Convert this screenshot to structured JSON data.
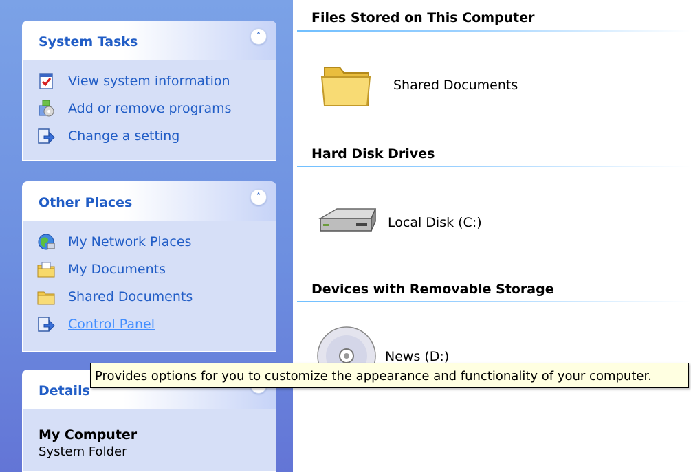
{
  "task_pane": {
    "system_tasks": {
      "title": "System Tasks",
      "items": [
        {
          "label": "View system information",
          "icon": "system-info-icon"
        },
        {
          "label": "Add or remove programs",
          "icon": "add-remove-programs-icon"
        },
        {
          "label": "Change a setting",
          "icon": "control-panel-icon"
        }
      ]
    },
    "other_places": {
      "title": "Other Places",
      "items": [
        {
          "label": "My Network Places",
          "icon": "network-places-icon"
        },
        {
          "label": "My Documents",
          "icon": "my-documents-icon"
        },
        {
          "label": "Shared Documents",
          "icon": "folder-icon"
        },
        {
          "label": "Control Panel",
          "icon": "control-panel-icon"
        }
      ]
    },
    "details": {
      "title": "Details",
      "name": "My Computer",
      "type": "System Folder"
    }
  },
  "content": {
    "groups": [
      {
        "header": "Files Stored on This Computer",
        "items": [
          {
            "label": "Shared Documents",
            "icon": "folder-icon"
          }
        ]
      },
      {
        "header": "Hard Disk Drives",
        "items": [
          {
            "label": "Local Disk (C:)",
            "icon": "hard-drive-icon"
          }
        ]
      },
      {
        "header": "Devices with Removable Storage",
        "items": [
          {
            "label": "News (D:)",
            "icon": "cd-drive-icon"
          }
        ]
      }
    ]
  },
  "tooltip": {
    "text": "Provides options for you to customize the appearance and functionality of your computer."
  },
  "colors": {
    "pane_gradient_top": "#7ba2e7",
    "pane_gradient_bottom": "#6375d6",
    "link_blue": "#215dc6",
    "panel_body": "#d6dff7",
    "tooltip_bg": "#ffffe1"
  }
}
